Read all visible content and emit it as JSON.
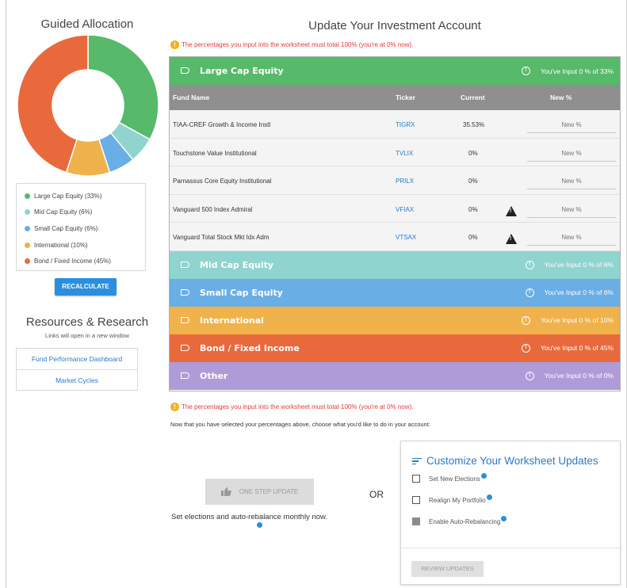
{
  "guided_allocation": {
    "title": "Guided Allocation",
    "segments": [
      {
        "label": "Large Cap Equity (33%)",
        "value": 33,
        "color": "#57b96a"
      },
      {
        "label": "Mid Cap Equity (6%)",
        "value": 6,
        "color": "#8fd4cf"
      },
      {
        "label": "Small Cap Equity (6%)",
        "value": 6,
        "color": "#6aaee6"
      },
      {
        "label": "International (10%)",
        "value": 10,
        "color": "#f0b24a"
      },
      {
        "label": "Bond / Fixed Income (45%)",
        "value": 45,
        "color": "#e86a3c"
      }
    ],
    "recalculate_label": "RECALCULATE"
  },
  "resources": {
    "title": "Resources & Research",
    "subtitle": "Links will open in a new window",
    "links": [
      "Fund Performance Dashboard",
      "Market Cycles"
    ]
  },
  "main": {
    "title": "Update Your Investment Account",
    "warning": "The percentages you input into the worksheet must total 100% (you're at 0% now).",
    "columns": {
      "fund": "Fund Name",
      "ticker": "Ticker",
      "current": "Current",
      "new": "New %"
    },
    "categories": [
      {
        "label": "Large Cap Equity",
        "status": "You've Input 0 % of 33%",
        "color": "#57b96a"
      },
      {
        "label": "Mid Cap Equity",
        "status": "You've Input 0 % of 6%",
        "color": "#8fd4cf"
      },
      {
        "label": "Small Cap Equity",
        "status": "You've Input 0 % of 6%",
        "color": "#6aaee6"
      },
      {
        "label": "International",
        "status": "You've Input 0 % of 10%",
        "color": "#f0b24a"
      },
      {
        "label": "Bond / Fixed Income",
        "status": "You've Input 0 % of 45%",
        "color": "#e86a3c"
      },
      {
        "label": "Other",
        "status": "You've Input 0 % of 0%",
        "color": "#b09bd9"
      }
    ],
    "funds": [
      {
        "name": "TIAA-CREF Growth & Income Instl",
        "ticker": "TIGRX",
        "current": "35.53%",
        "alert": false
      },
      {
        "name": "Touchstone Value Institutional",
        "ticker": "TVLIX",
        "current": "0%",
        "alert": false
      },
      {
        "name": "Parnassus Core Equity Institutional",
        "ticker": "PRILX",
        "current": "0%",
        "alert": false
      },
      {
        "name": "Vanguard 500 Index Admiral",
        "ticker": "VFIAX",
        "current": "0%",
        "alert": true
      },
      {
        "name": "Vanguard Total Stock Mkt Idx Adm",
        "ticker": "VTSAX",
        "current": "0%",
        "alert": true
      }
    ],
    "new_pct_placeholder": "New %",
    "instructions": "Now that you have selected your percentages above, choose what you'd like to do in your account:",
    "one_step_label": "ONE STEP UPDATE",
    "one_step_desc": "Set elections and auto-rebalance monthly now.",
    "or_text": "OR"
  },
  "customize": {
    "title": "Customize Your Worksheet Updates",
    "options": [
      {
        "label": "Set New Elections",
        "filled": false
      },
      {
        "label": "Realign My Portfolio",
        "filled": false
      },
      {
        "label": "Enable Auto-Rebalancing",
        "filled": true
      }
    ],
    "review_label": "REVIEW UPDATES"
  }
}
